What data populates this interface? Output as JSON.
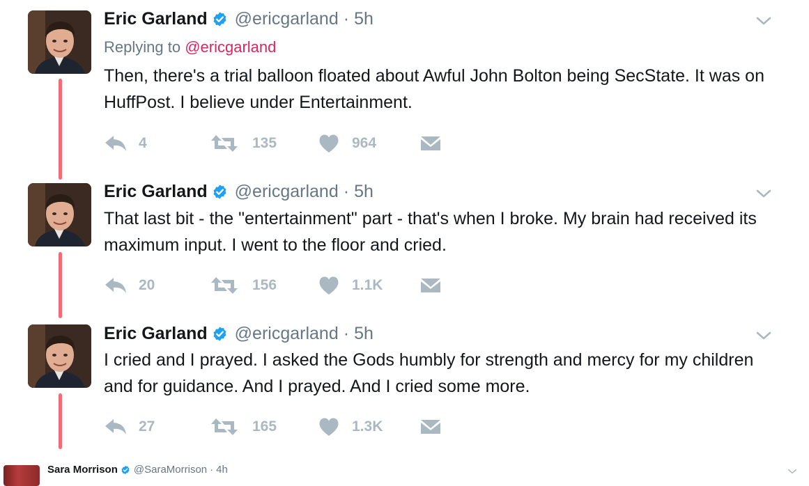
{
  "tweets": [
    {
      "name": "Eric Garland",
      "handle": "@ericgarland",
      "separator": "·",
      "time": "5h",
      "replying_prefix": "Replying to",
      "replying_handle": "@ericgarland",
      "text": "Then, there's a trial balloon floated about Awful John Bolton being SecState. It was on HuffPost. I believe under Entertainment.",
      "reply_count": "4",
      "retweet_count": "135",
      "like_count": "964"
    },
    {
      "name": "Eric Garland",
      "handle": "@ericgarland",
      "separator": "·",
      "time": "5h",
      "text": "That last bit - the \"entertainment\" part - that's when I broke. My brain had received its maximum input. I went to the floor and cried.",
      "reply_count": "20",
      "retweet_count": "156",
      "like_count": "1.1K"
    },
    {
      "name": "Eric Garland",
      "handle": "@ericgarland",
      "separator": "·",
      "time": "5h",
      "text": "I cried and I prayed. I asked the Gods humbly for strength and mercy for my children and for guidance. And I prayed. And I cried some more.",
      "reply_count": "27",
      "retweet_count": "165",
      "like_count": "1.3K"
    }
  ],
  "next_tweet": {
    "name": "Sara Morrison",
    "handle": "@SaraMorrison",
    "separator": "·",
    "time": "4h"
  },
  "icons": {
    "verified": "verified-badge-icon",
    "reply": "reply-icon",
    "retweet": "retweet-icon",
    "like": "heart-icon",
    "dm": "envelope-icon",
    "caret": "chevron-down-icon"
  },
  "colors": {
    "thread_line": "#f36b74",
    "verified": "#1da1f2",
    "reply_link": "#e0245e",
    "action_gray": "#aab8c2",
    "meta_gray": "#657786"
  }
}
